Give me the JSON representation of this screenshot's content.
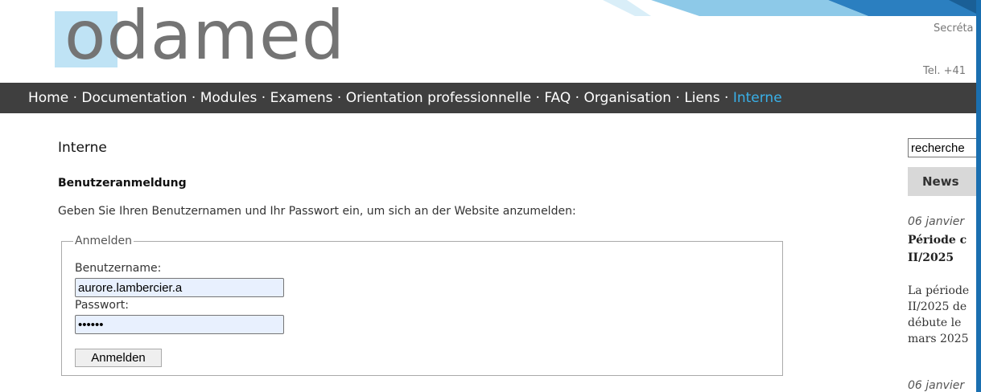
{
  "header": {
    "logo_text": "odamed",
    "right_text_1": "Secréta",
    "right_text_2": "Tel. +41"
  },
  "nav": {
    "items": [
      {
        "label": "Home"
      },
      {
        "label": "Documentation"
      },
      {
        "label": "Modules"
      },
      {
        "label": "Examens"
      },
      {
        "label": "Orientation professionnelle"
      },
      {
        "label": "FAQ"
      },
      {
        "label": "Organisation"
      },
      {
        "label": "Liens"
      },
      {
        "label": "Interne"
      }
    ],
    "separator": " · ",
    "active_color": "#39b0e8",
    "bar_color": "#3f3f3f"
  },
  "main": {
    "title": "Interne",
    "subtitle": "Benutzeranmeldung",
    "intro": "Geben Sie Ihren Benutzernamen und Ihr Passwort ein, um sich an der Website anzumelden:",
    "form": {
      "legend": "Anmelden",
      "username_label": "Benutzername:",
      "username_value": "aurore.lambercier.a",
      "password_label": "Passwort:",
      "password_value": "••••••",
      "submit_label": "Anmelden"
    }
  },
  "sidebar": {
    "search_value": "recherche",
    "news_header": "News",
    "news": [
      {
        "date": "06 janvier",
        "title_lines": [
          "Période c",
          "II/2025"
        ],
        "body_lines": [
          "La période",
          "II/2025 de",
          "débute le",
          "mars 2025"
        ]
      },
      {
        "date": "06 janvier"
      }
    ]
  },
  "colors": {
    "logo_block": "#bfe3f5",
    "logo_text": "#747474",
    "input_bg": "#e8f0fe",
    "accent": "#1a6fb0"
  }
}
